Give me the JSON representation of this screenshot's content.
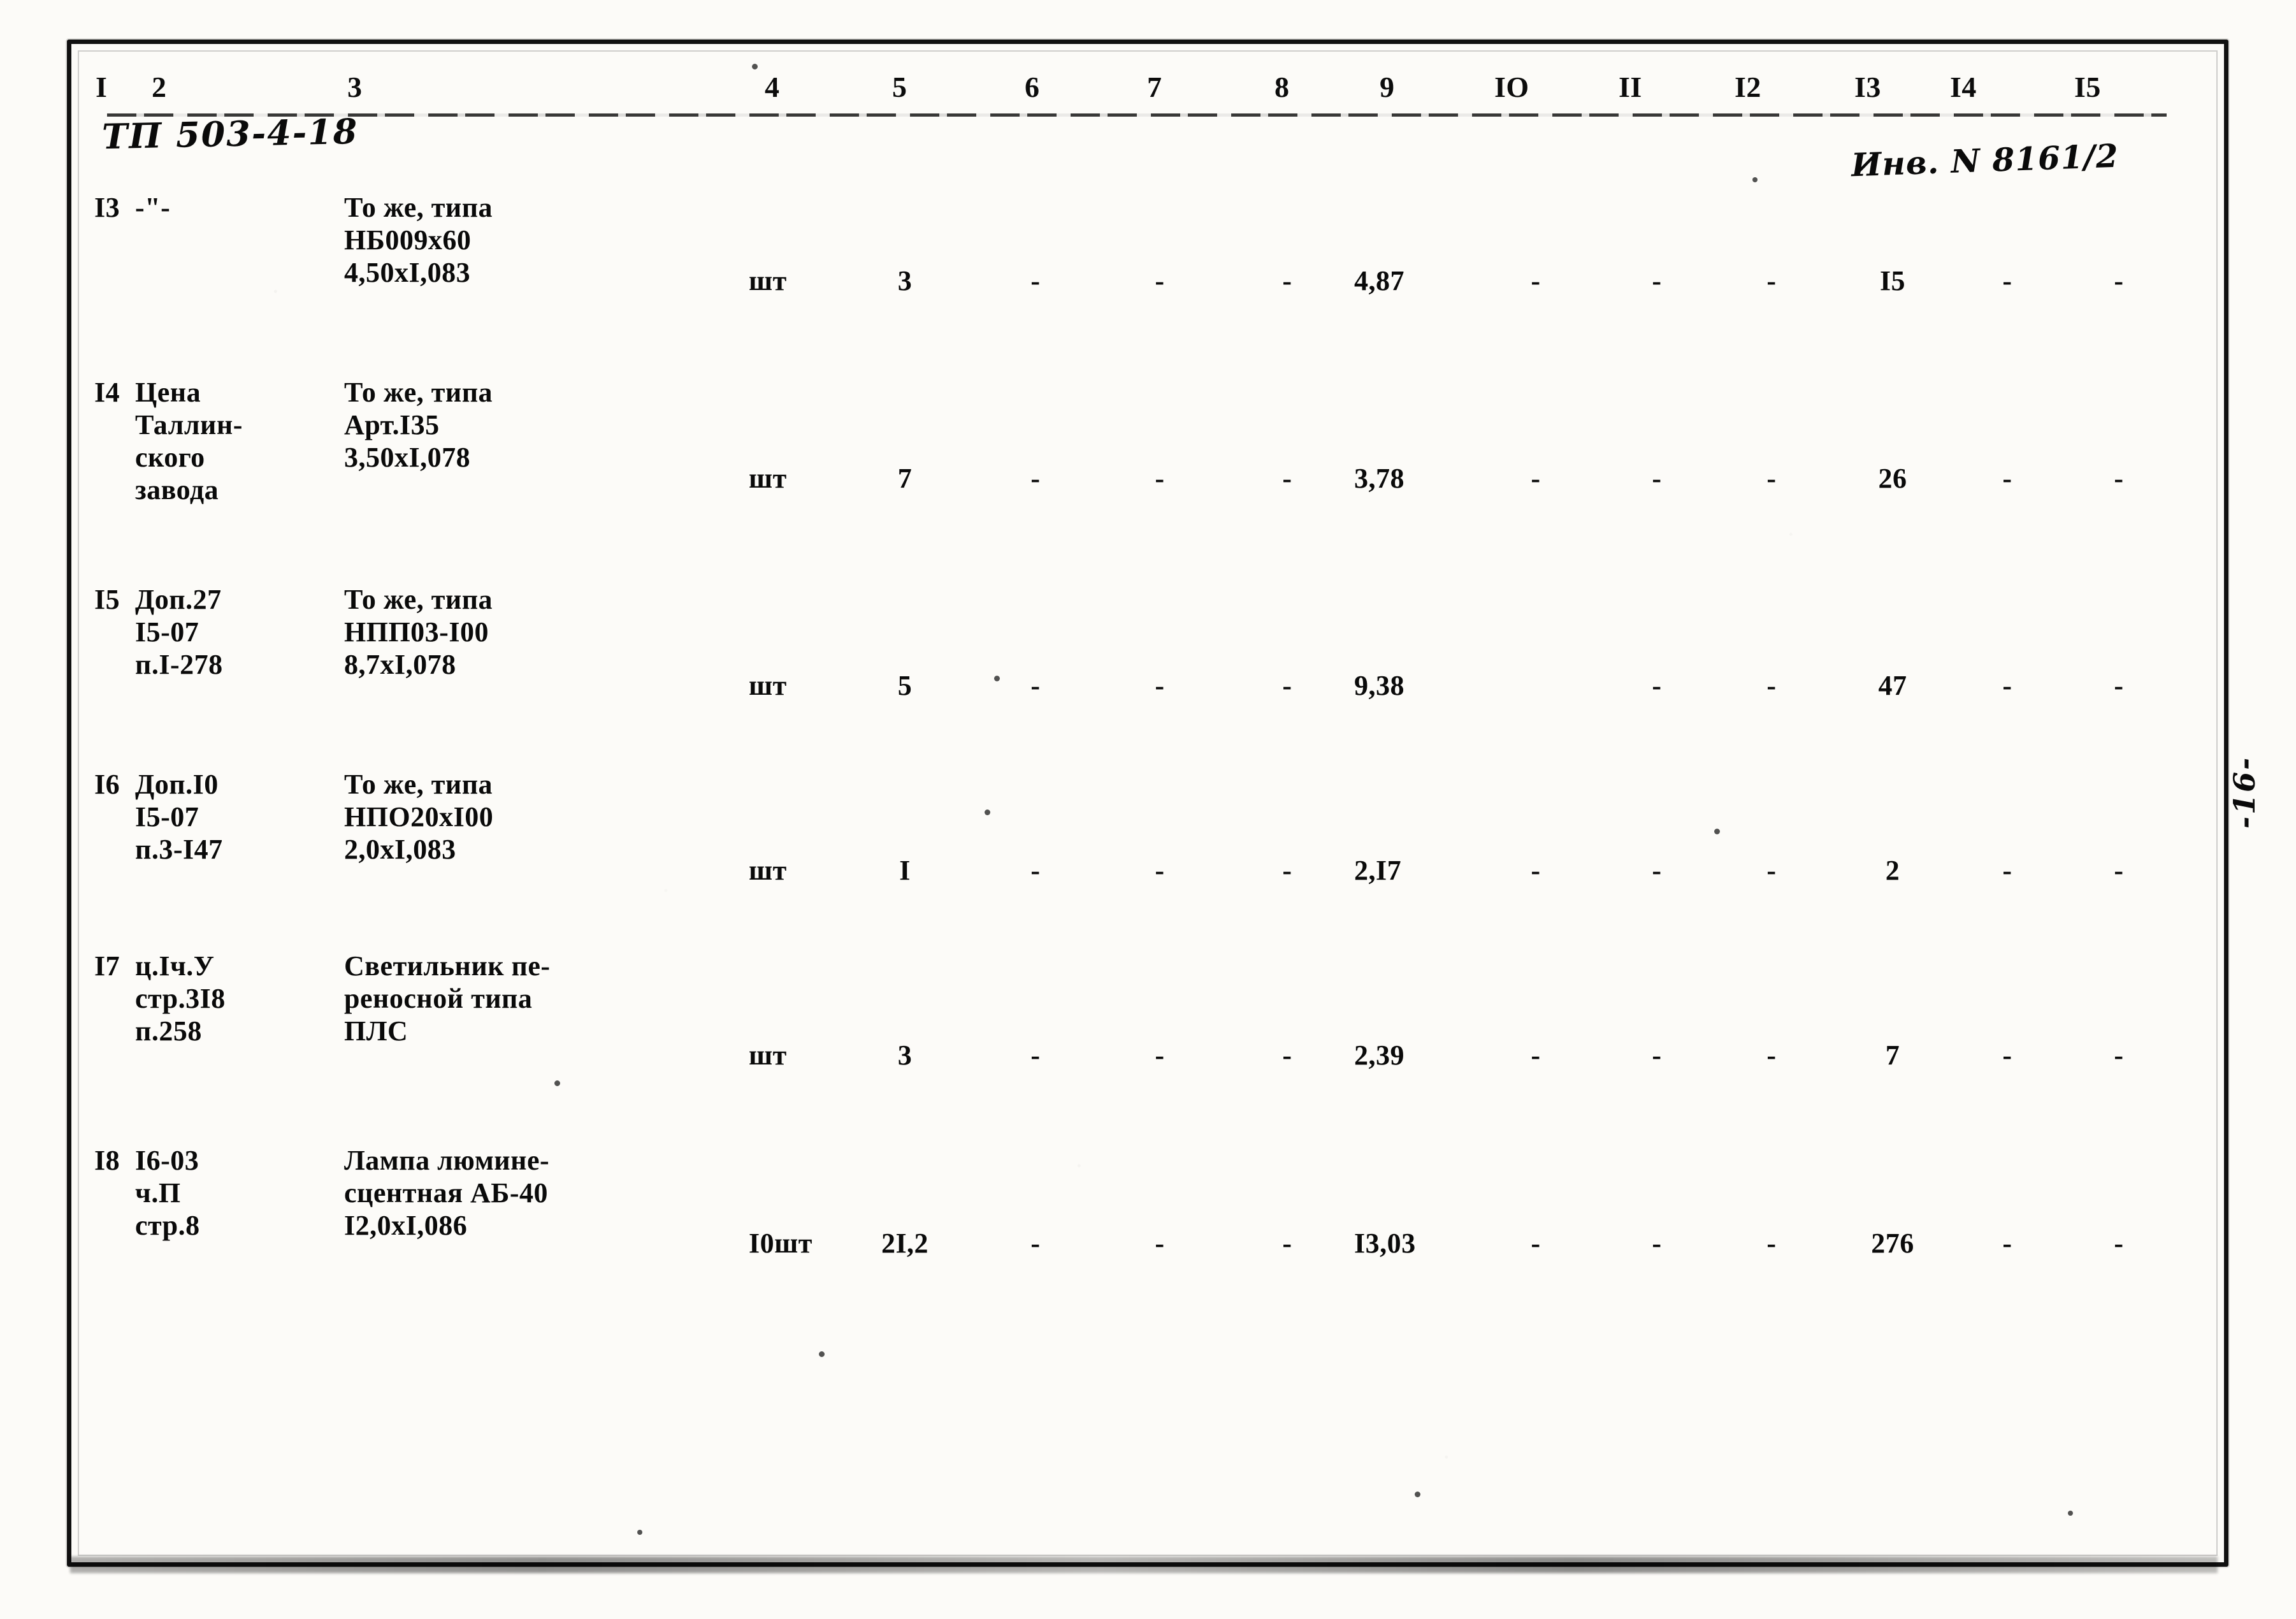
{
  "document": {
    "tp_code_handwritten": "ТП 503-4-18",
    "inventory_handwritten": "Инв. N 8161/2",
    "margin_note_handwritten": "-16-"
  },
  "table": {
    "column_headers": [
      "I",
      "2",
      "3",
      "4",
      "5",
      "6",
      "7",
      "8",
      "9",
      "IO",
      "II",
      "I2",
      "I3",
      "I4",
      "I5"
    ],
    "rows": [
      {
        "num": "I3",
        "source": [
          "-\"-"
        ],
        "name": [
          "То же, типа",
          "НБ009х60",
          "4,50хI,083"
        ],
        "unit": "шт",
        "qty": "3",
        "c6": "-",
        "c7": "-",
        "c8": "-",
        "c9": "4,87",
        "c10": "-",
        "c11": "-",
        "c12": "-",
        "c13": "I5",
        "c14": "-",
        "c15": "-"
      },
      {
        "num": "I4",
        "source": [
          "Цена",
          "Таллин-",
          "ского",
          "завода"
        ],
        "name": [
          "То же, типа",
          "Арт.I35",
          "3,50хI,078"
        ],
        "unit": "шт",
        "qty": "7",
        "c6": "-",
        "c7": "-",
        "c8": "-",
        "c9": "3,78",
        "c10": "-",
        "c11": "-",
        "c12": "-",
        "c13": "26",
        "c14": "-",
        "c15": "-"
      },
      {
        "num": "I5",
        "source": [
          "Доп.27",
          "I5-07",
          "п.I-278"
        ],
        "name": [
          "То же, типа",
          "НПП03-I00",
          "8,7хI,078"
        ],
        "unit": "шт",
        "qty": "5",
        "c6": "-",
        "c7": "-",
        "c8": "-",
        "c9": "9,38",
        "c10": "",
        "c11": "-",
        "c12": "-",
        "c13": "47",
        "c14": "-",
        "c15": "-"
      },
      {
        "num": "I6",
        "source": [
          "Доп.I0",
          "I5-07",
          "п.3-I47"
        ],
        "name": [
          "То же, типа",
          "НПО20хI00",
          "2,0хI,083"
        ],
        "unit": "шт",
        "qty": "I",
        "c6": "-",
        "c7": "-",
        "c8": "-",
        "c9": "2,I7",
        "c10": "-",
        "c11": "-",
        "c12": "-",
        "c13": "2",
        "c14": "-",
        "c15": "-"
      },
      {
        "num": "I7",
        "source": [
          "ц.Iч.У",
          "стр.3I8",
          "п.258"
        ],
        "name": [
          "Светильник пе-",
          "реносной типа",
          "ПЛС"
        ],
        "unit": "шт",
        "qty": "3",
        "c6": "-",
        "c7": "-",
        "c8": "-",
        "c9": "2,39",
        "c10": "-",
        "c11": "-",
        "c12": "-",
        "c13": "7",
        "c14": "-",
        "c15": "-"
      },
      {
        "num": "I8",
        "source": [
          "I6-03",
          "ч.П",
          "стр.8"
        ],
        "name": [
          "Лампа люмине-",
          "сцентная АБ-40",
          "I2,0хI,086"
        ],
        "unit": "I0шт",
        "qty": "2I,2",
        "c6": "-",
        "c7": "-",
        "c8": "-",
        "c9": "I3,03",
        "c10": "-",
        "c11": "-",
        "c12": "-",
        "c13": "276",
        "c14": "-",
        "c15": "-"
      }
    ]
  }
}
